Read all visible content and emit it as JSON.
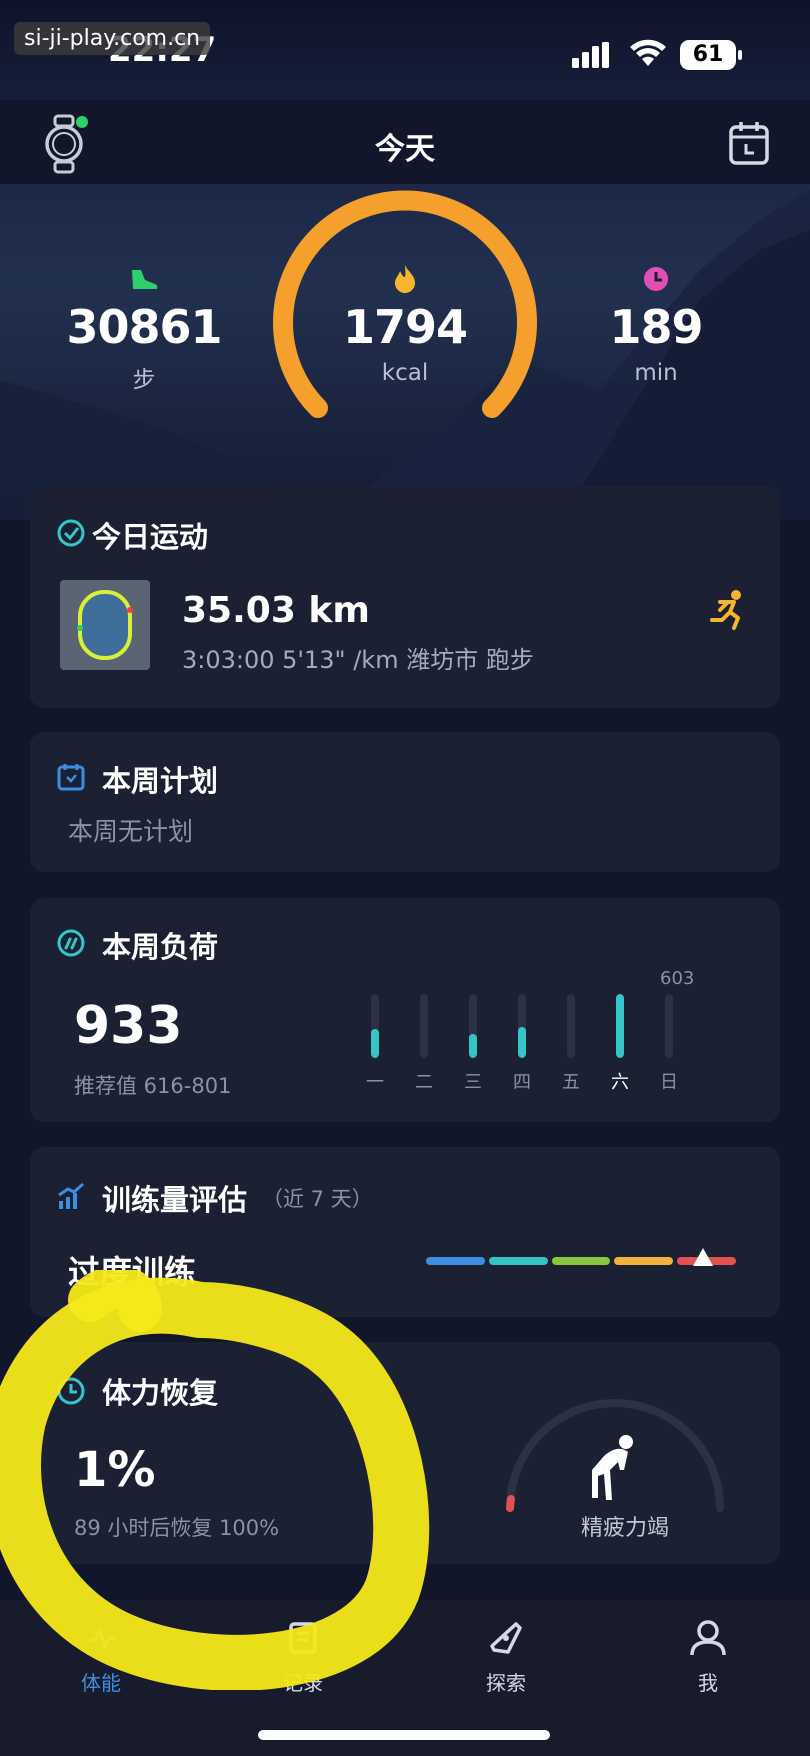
{
  "watermark": "si-ji-play.com.cn",
  "status": {
    "time": "22:27",
    "battery": "61"
  },
  "nav": {
    "title": "今天"
  },
  "summary": {
    "steps": {
      "value": "30861",
      "unit": "步"
    },
    "calories": {
      "value": "1794",
      "unit": "kcal"
    },
    "minutes": {
      "value": "189",
      "unit": "min"
    }
  },
  "today_workout": {
    "title": "今日运动",
    "distance": "35.03 km",
    "details": "3:03:00  5'13\" /km 潍坊市 跑步"
  },
  "weekly_plan": {
    "title": "本周计划",
    "subtitle": "本周无计划"
  },
  "weekly_load": {
    "title": "本周负荷",
    "value": "933",
    "recommend": "推荐值 616-801",
    "peak_label": "603",
    "days": [
      "一",
      "二",
      "三",
      "四",
      "五",
      "六",
      "日"
    ],
    "levels": [
      0.45,
      0.0,
      0.38,
      0.48,
      0.0,
      1.0,
      0.0
    ],
    "bar_color": "#35c6c9"
  },
  "training_volume": {
    "title": "训练量评估",
    "period": "（近 7 天）",
    "status": "过度训练",
    "scale_colors": [
      "#3e8ee0",
      "#34c3c3",
      "#8cc63e",
      "#f0b23a",
      "#e2504f"
    ]
  },
  "recovery": {
    "title": "体力恢复",
    "value": "1%",
    "detail": "89 小时后恢复 100%",
    "state": "精疲力竭"
  },
  "tabs": {
    "fitness": "体能",
    "records": "记录",
    "explore": "探索",
    "me": "我"
  },
  "colors": {
    "accent_orange": "#f5a02c",
    "teal": "#35c6c9",
    "card": "#1b2033"
  }
}
